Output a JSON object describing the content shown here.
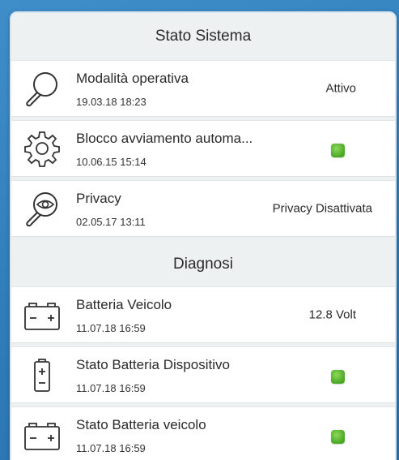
{
  "system": {
    "header": "Stato Sistema",
    "items": [
      {
        "icon": "magnifier-icon",
        "title": "Modalità operativa",
        "date": "19.03.18 18:23",
        "value": "Attivo"
      },
      {
        "icon": "gear-icon",
        "title": "Blocco avviamento automa...",
        "date": "10.06.15 15:14",
        "status": "ok",
        "status_color": "#5ab82f"
      },
      {
        "icon": "privacy-eye-magnifier-icon",
        "title": "Privacy",
        "date": "02.05.17 13:11",
        "value": "Privacy Disattivata"
      }
    ]
  },
  "diagnosis": {
    "header": "Diagnosi",
    "items": [
      {
        "icon": "car-battery-icon",
        "title": "Batteria Veicolo",
        "date": "11.07.18 16:59",
        "value": "12.8 Volt"
      },
      {
        "icon": "device-battery-icon",
        "title": "Stato Batteria Dispositivo",
        "date": "11.07.18 16:59",
        "status": "ok",
        "status_color": "#5ab82f"
      },
      {
        "icon": "car-battery-icon",
        "title": "Stato Batteria veicolo",
        "date": "11.07.18 16:59",
        "status": "ok",
        "status_color": "#5ab82f"
      }
    ]
  }
}
